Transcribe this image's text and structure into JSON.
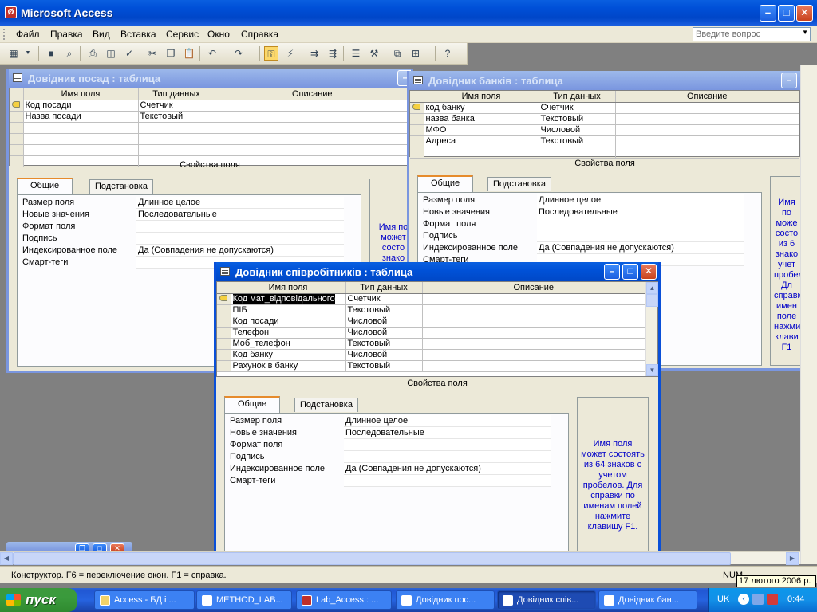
{
  "app": {
    "title": "Microsoft Access",
    "menus": [
      "Файл",
      "Правка",
      "Вид",
      "Вставка",
      "Сервис",
      "Окно",
      "Справка"
    ],
    "ask_placeholder": "Введите вопрос"
  },
  "columns": {
    "name": "Имя поля",
    "type": "Тип данных",
    "desc": "Описание"
  },
  "props_title": "Свойства поля",
  "tabs": {
    "general": "Общие",
    "lookup": "Подстановка"
  },
  "prop_labels": [
    "Размер поля",
    "Новые значения",
    "Формат поля",
    "Подпись",
    "Индексированное поле",
    "Смарт-теги"
  ],
  "prop_values": [
    "Длинное целое",
    "Последовательные",
    "",
    "",
    "Да (Совпадения не допускаются)",
    ""
  ],
  "hint_text": "Имя поля может состоять из 64 знаков с учетом пробелов.  Для справки по именам полей нажмите клавишу F1.",
  "windows": {
    "posad": {
      "title": "Довідник посад : таблица",
      "fields": [
        {
          "name": "Код посади",
          "type": "Счетчик"
        },
        {
          "name": "Назва посади",
          "type": "Текстовый"
        }
      ],
      "hint_partial": "Имя по может состо знако"
    },
    "bank": {
      "title": "Довідник банків : таблица",
      "fields": [
        {
          "name": "код банку",
          "type": "Счетчик"
        },
        {
          "name": "назва банка",
          "type": "Текстовый"
        },
        {
          "name": "МФО",
          "type": "Числовой"
        },
        {
          "name": "Адреса",
          "type": "Текстовый"
        }
      ],
      "hint_partial": "Имя по може состо из 6 знако учет пробел Дл справк имен поле нажми клави F1"
    },
    "employees": {
      "title": "Довідник співробітників : таблица",
      "fields": [
        {
          "name": "Код мат_відповідального",
          "type": "Счетчик"
        },
        {
          "name": "ПІБ",
          "type": "Текстовый"
        },
        {
          "name": "Код посади",
          "type": "Числовой"
        },
        {
          "name": "Телефон",
          "type": "Числовой"
        },
        {
          "name": "Моб_телефон",
          "type": "Текстовый"
        },
        {
          "name": "Код банку",
          "type": "Числовой"
        },
        {
          "name": "Рахунок в банку",
          "type": "Текстовый"
        }
      ]
    }
  },
  "status": {
    "text": "Конструктор.  F6 = переключение окон.  F1 = справка.",
    "num": "NUM"
  },
  "tooltip": "17 лютого 2006 р.",
  "taskbar": {
    "start": "пуск",
    "tasks": [
      "Access - БД і ...",
      "METHOD_LAB...",
      "Lab_Access : ...",
      "Довідник пос...",
      "Довідник спів...",
      "Довідник бан..."
    ],
    "lang": "UK",
    "clock": "0:44"
  },
  "colors": {
    "title_blue": "#0a50d8",
    "hint_text": "#0000c8",
    "taskbar": "#245edb",
    "start_green": "#3a9a3c"
  }
}
